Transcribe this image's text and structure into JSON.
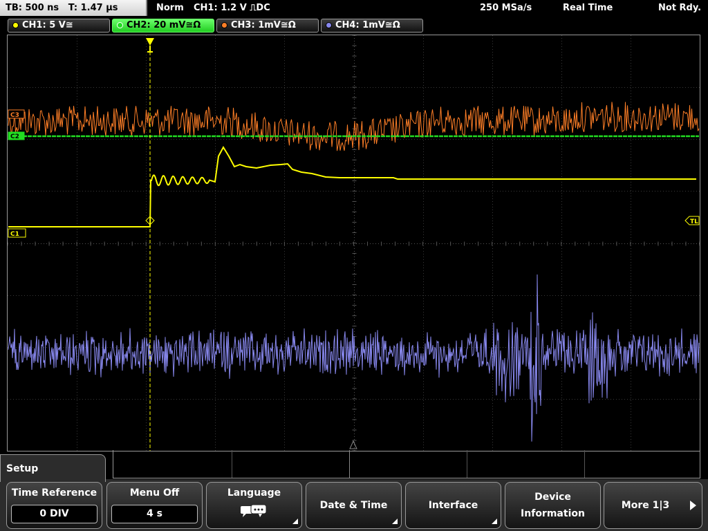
{
  "header": {
    "timebase": "TB: 500 ns",
    "trigger_time": "T: 1.47 µs",
    "trigger_mode": "Norm",
    "trigger_setting": "CH1: 1.2 V ⎍DC",
    "sample_rate": "250 MSa/s",
    "acq_mode": "Real Time",
    "status": "Not Rdy."
  },
  "channels": [
    {
      "name": "CH1",
      "label": "CH1: 5 V≅",
      "color": "#ffff00",
      "active": false
    },
    {
      "name": "CH2",
      "label": "CH2: 20 mV≅Ω",
      "color": "#22dd22",
      "active": true
    },
    {
      "name": "CH3",
      "label": "CH3: 1mV≅Ω",
      "color": "#ff7f27",
      "active": false
    },
    {
      "name": "CH4",
      "label": "CH4: 1mV≅Ω",
      "color": "#8888ee",
      "active": false
    }
  ],
  "markers": {
    "c3": "C3",
    "c2": "C2",
    "c1": "C1",
    "trigger_level": "TL",
    "trigger_pos": "T"
  },
  "menu": {
    "title": "Setup",
    "time_reference": {
      "label": "Time Reference",
      "value": "0 DIV"
    },
    "menu_off": {
      "label": "Menu Off",
      "value": "4 s"
    },
    "language": {
      "label": "Language",
      "icon": "speech-bubbles-icon"
    },
    "date_time": {
      "label": "Date & Time"
    },
    "interface": {
      "label": "Interface"
    },
    "device_info": {
      "label1": "Device",
      "label2": "Information"
    },
    "more": {
      "label": "More 1|3"
    }
  },
  "colors": {
    "ch1": "#ffff00",
    "ch2": "#22dd22",
    "ch3": "#ff7f27",
    "ch4": "#8888ee",
    "grid": "#4a4a4a",
    "active_tab": "#33ee33"
  }
}
